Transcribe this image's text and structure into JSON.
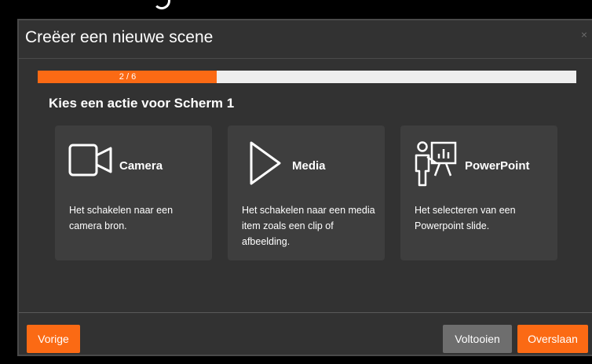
{
  "dialog": {
    "title": "Creëer een nieuwe scene",
    "close_glyph": "×",
    "progress": {
      "text": "2 / 6",
      "value": 0.333,
      "color": "#fb6a14"
    },
    "subtitle": "Kies een actie voor Scherm 1",
    "cards": [
      {
        "icon": "camera-icon",
        "label": "Camera",
        "description": "Het schakelen naar een camera bron."
      },
      {
        "icon": "play-icon",
        "label": "Media",
        "description": "Het schakelen naar een media item zoals een clip of afbeelding."
      },
      {
        "icon": "presenter-icon",
        "label": "PowerPoint",
        "description": "Het selecteren van een Powerpoint slide."
      }
    ],
    "footer": {
      "back_label": "Vorige",
      "finish_label": "Voltooien",
      "skip_label": "Overslaan"
    }
  },
  "colors": {
    "accent": "#fb6a14",
    "background": "#323232",
    "card": "#3e3e3e",
    "button_gray": "#6e6e6e"
  }
}
